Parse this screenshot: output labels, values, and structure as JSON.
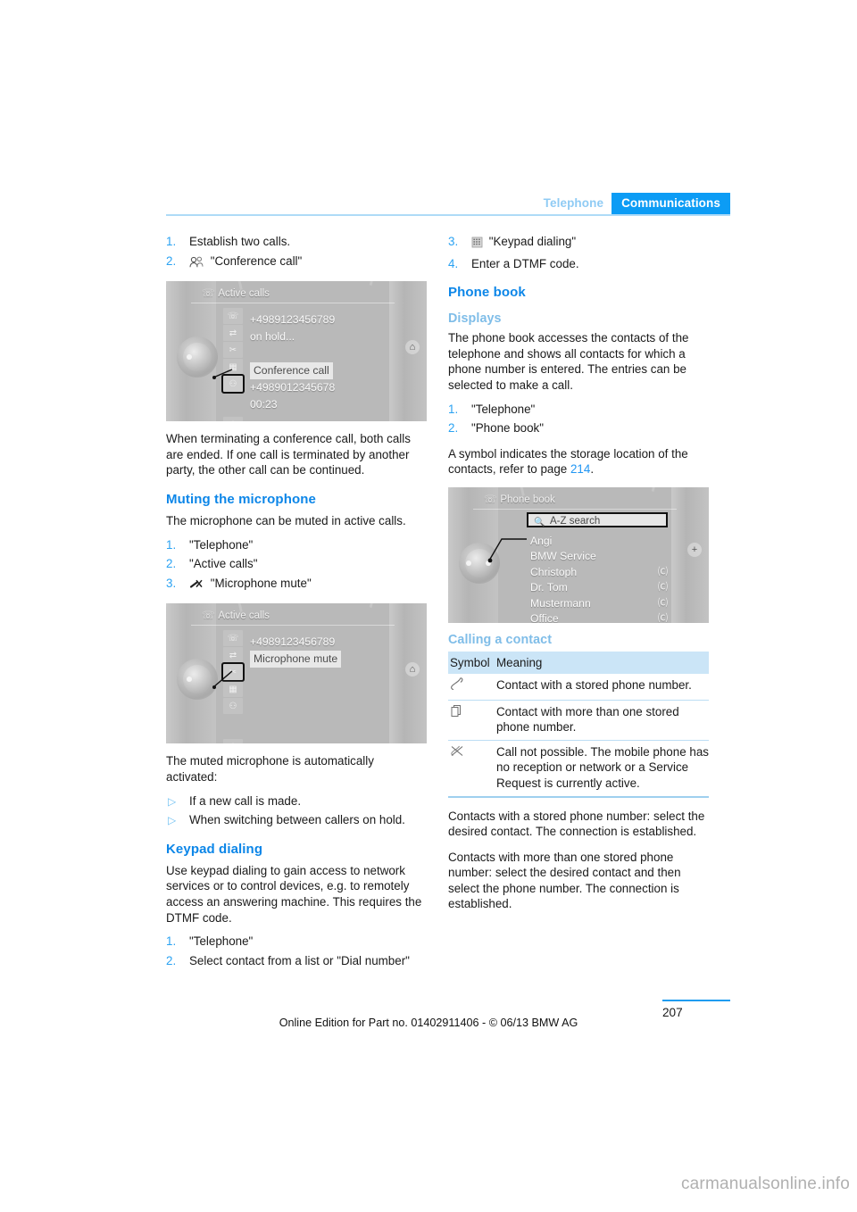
{
  "header": {
    "tab_inactive": "Telephone",
    "tab_active": "Communications",
    "accent_color": "#0c9cf5",
    "rule_color": "#aedbf7"
  },
  "left_column": {
    "steps_conference": [
      {
        "num": "1.",
        "icon": "",
        "text": "Establish two calls."
      },
      {
        "num": "2.",
        "icon": "conference-call-icon",
        "text": "\"Conference call\""
      }
    ],
    "screenshot_active_calls_1": {
      "title": "Active calls",
      "lines": [
        "+4989123456789",
        "on hold..."
      ],
      "highlight": "Conference call",
      "lines_after": [
        "+4989012345678",
        "00:23"
      ]
    },
    "paragraph_conference": "When terminating a conference call, both calls are ended. If one call is terminated by another party, the other call can be continued.",
    "heading_muting": "Muting the microphone",
    "paragraph_muting": "The microphone can be muted in active calls.",
    "steps_muting": [
      {
        "num": "1.",
        "icon": "",
        "text": "\"Telephone\""
      },
      {
        "num": "2.",
        "icon": "",
        "text": "\"Active calls\""
      },
      {
        "num": "3.",
        "icon": "microphone-mute-icon",
        "text": "\"Microphone mute\""
      }
    ],
    "screenshot_active_calls_2": {
      "title": "Active calls",
      "lines": [
        "+4989123456789"
      ],
      "highlight": "Microphone mute"
    },
    "paragraph_auto": "The muted microphone is automatically activated:",
    "bullets_auto": [
      "If a new call is made.",
      "When switching between callers on hold."
    ],
    "heading_keypad": "Keypad dialing",
    "paragraph_keypad": "Use keypad dialing to gain access to network services or to control devices, e.g. to remotely access an answering machine. This requires the DTMF code.",
    "steps_keypad": [
      {
        "num": "1.",
        "icon": "",
        "text": "\"Telephone\""
      },
      {
        "num": "2.",
        "icon": "",
        "text": "Select contact from a list or \"Dial number\""
      }
    ]
  },
  "right_column": {
    "steps_keypad_cont": [
      {
        "num": "3.",
        "icon": "keypad-icon",
        "text": "\"Keypad dialing\""
      },
      {
        "num": "4.",
        "icon": "",
        "text": "Enter a DTMF code."
      }
    ],
    "heading_phonebook": "Phone book",
    "subheading_displays": "Displays",
    "paragraph_displays": "The phone book accesses the contacts of the telephone and shows all contacts for which a phone number is entered. The entries can be selected to make a call.",
    "steps_displays": [
      {
        "num": "1.",
        "icon": "",
        "text": "\"Telephone\""
      },
      {
        "num": "2.",
        "icon": "",
        "text": "\"Phone book\""
      }
    ],
    "paragraph_symbol_pre": "A symbol indicates the storage location of the contacts, refer to page ",
    "paragraph_symbol_ref": "214",
    "paragraph_symbol_post": ".",
    "screenshot_phonebook": {
      "title": "Phone book",
      "search_label": "A-Z search",
      "contacts": [
        {
          "name": "Angi",
          "symbol": ""
        },
        {
          "name": "BMW Service",
          "symbol": ""
        },
        {
          "name": "Christoph",
          "symbol": "⒞"
        },
        {
          "name": "Dr. Tom",
          "symbol": "⒞"
        },
        {
          "name": "Mustermann",
          "symbol": "⒞"
        },
        {
          "name": "Office",
          "symbol": "⒞"
        }
      ],
      "plus_label": "+"
    },
    "subheading_calling": "Calling a contact",
    "table": {
      "headers": [
        "Symbol",
        "Meaning"
      ],
      "rows": [
        {
          "symbol": "handset-icon",
          "glyph": "✆",
          "meaning": "Contact with a stored phone number."
        },
        {
          "symbol": "multiple-cards-icon",
          "glyph": "❐",
          "meaning": "Contact with more than one stored phone number."
        },
        {
          "symbol": "call-not-possible-icon",
          "glyph": "✂",
          "meaning": "Call not possible. The mobile phone has no reception or network or a Service Request is currently active."
        }
      ],
      "header_bg": "#cbe5f7"
    },
    "paragraph_stored": "Contacts with a stored phone number: select the desired contact. The connection is established.",
    "paragraph_multiple": "Contacts with more than one stored phone number: select the desired contact and then select the phone number. The connection is established."
  },
  "footer": {
    "note": "Online Edition for Part no. 01402911406 - © 06/13 BMW AG",
    "page_number": "207",
    "watermark": "carmanualsonline.info"
  }
}
